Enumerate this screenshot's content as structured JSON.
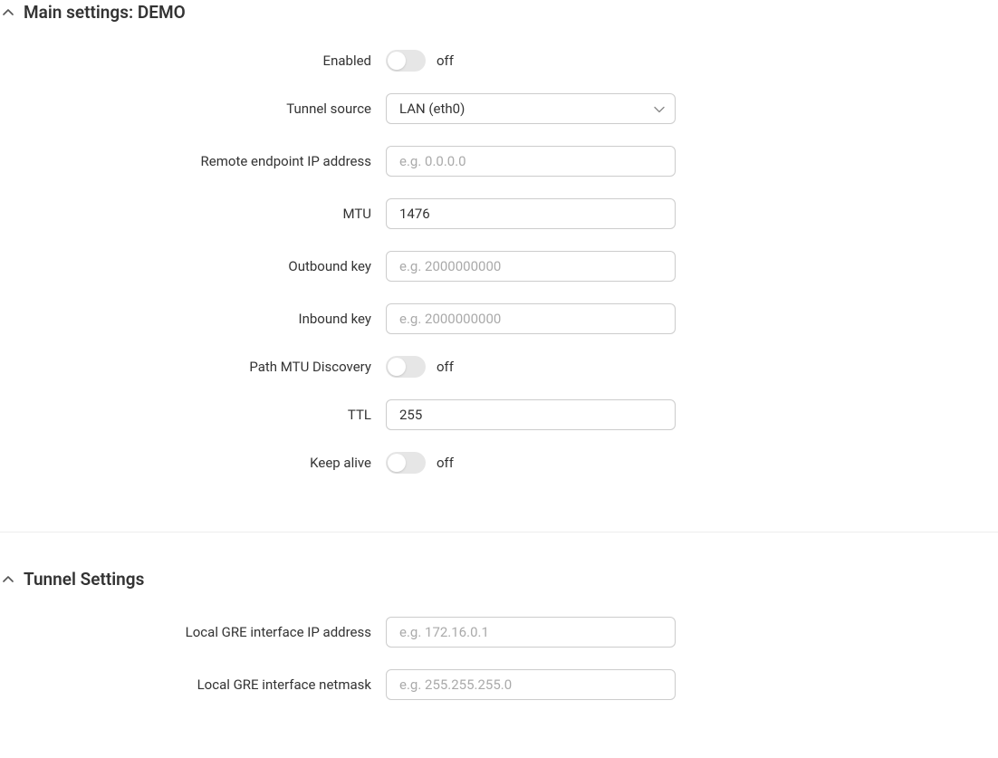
{
  "main": {
    "title": "Main settings: DEMO",
    "enabled": {
      "label": "Enabled",
      "state": "off"
    },
    "tunnel_source": {
      "label": "Tunnel source",
      "value": "LAN (eth0)"
    },
    "remote_endpoint": {
      "label": "Remote endpoint IP address",
      "value": "",
      "placeholder": "e.g. 0.0.0.0"
    },
    "mtu": {
      "label": "MTU",
      "value": "1476"
    },
    "outbound_key": {
      "label": "Outbound key",
      "value": "",
      "placeholder": "e.g. 2000000000"
    },
    "inbound_key": {
      "label": "Inbound key",
      "value": "",
      "placeholder": "e.g. 2000000000"
    },
    "pmtu": {
      "label": "Path MTU Discovery",
      "state": "off"
    },
    "ttl": {
      "label": "TTL",
      "value": "255"
    },
    "keepalive": {
      "label": "Keep alive",
      "state": "off"
    }
  },
  "tunnel": {
    "title": "Tunnel Settings",
    "local_ip": {
      "label": "Local GRE interface IP address",
      "value": "",
      "placeholder": "e.g. 172.16.0.1"
    },
    "local_netmask": {
      "label": "Local GRE interface netmask",
      "value": "",
      "placeholder": "e.g. 255.255.255.0"
    }
  }
}
